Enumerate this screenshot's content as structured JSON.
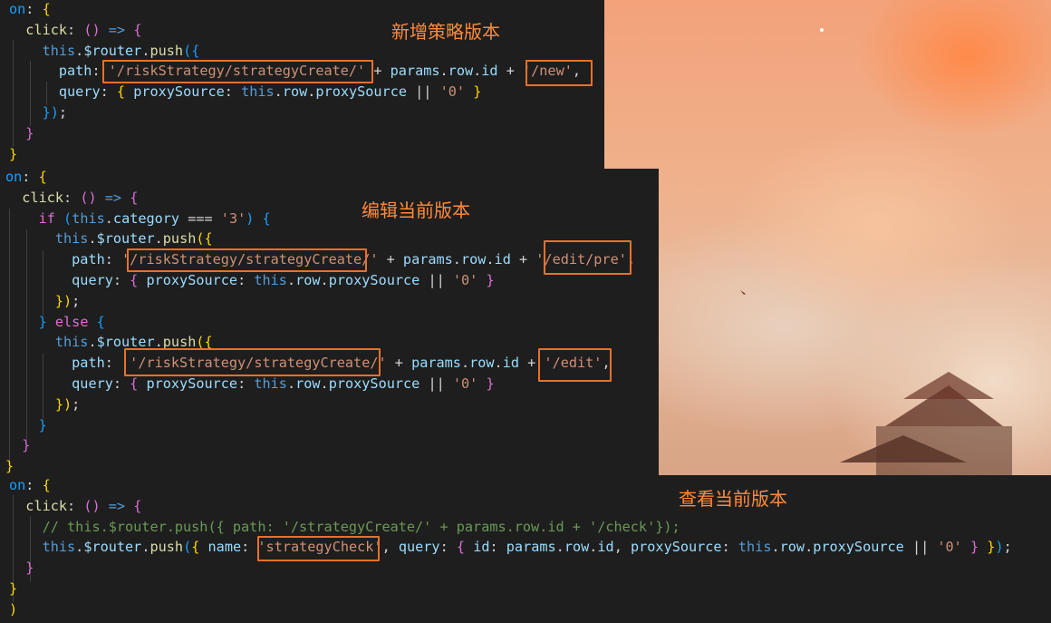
{
  "annotations": {
    "new_version": "新增策略版本",
    "edit_version": "编辑当前版本",
    "view_version": "查看当前版本"
  },
  "panel_1": {
    "lines": [
      [
        [
          "b",
          "on"
        ],
        [
          "w",
          ": "
        ],
        [
          "y",
          "{"
        ]
      ],
      [
        [
          "w",
          "  "
        ],
        [
          "f",
          "click"
        ],
        [
          "w",
          ": "
        ],
        [
          "pk",
          "()"
        ],
        [
          "w",
          " "
        ],
        [
          "k",
          "=>"
        ],
        [
          "w",
          " "
        ],
        [
          "pk",
          "{"
        ]
      ],
      [
        [
          "w",
          "    "
        ],
        [
          "k",
          "this"
        ],
        [
          "w",
          "."
        ],
        [
          "p",
          "$router"
        ],
        [
          "w",
          "."
        ],
        [
          "f",
          "push"
        ],
        [
          "b",
          "({"
        ]
      ],
      [
        [
          "w",
          "      "
        ],
        [
          "p",
          "path"
        ],
        [
          "w",
          ": "
        ],
        [
          "s",
          "'/riskStrategy/strategyCreate/'"
        ],
        [
          "w",
          " + "
        ],
        [
          "p",
          "params"
        ],
        [
          "w",
          "."
        ],
        [
          "p",
          "row"
        ],
        [
          "w",
          "."
        ],
        [
          "p",
          "id"
        ],
        [
          "w",
          " + "
        ],
        [
          "s",
          "'/new'"
        ],
        [
          "w",
          ","
        ]
      ],
      [
        [
          "w",
          "      "
        ],
        [
          "p",
          "query"
        ],
        [
          "w",
          ": "
        ],
        [
          "y",
          "{"
        ],
        [
          "w",
          " "
        ],
        [
          "p",
          "proxySource"
        ],
        [
          "w",
          ": "
        ],
        [
          "k",
          "this"
        ],
        [
          "w",
          "."
        ],
        [
          "p",
          "row"
        ],
        [
          "w",
          "."
        ],
        [
          "p",
          "proxySource"
        ],
        [
          "w",
          " || "
        ],
        [
          "s",
          "'0'"
        ],
        [
          "w",
          " "
        ],
        [
          "y",
          "}"
        ]
      ],
      [
        [
          "w",
          "    "
        ],
        [
          "b",
          "})"
        ],
        [
          "w",
          ";"
        ]
      ],
      [
        [
          "w",
          "  "
        ],
        [
          "pk",
          "}"
        ]
      ],
      [
        [
          "y",
          "}"
        ]
      ]
    ]
  },
  "panel_2": {
    "lines": [
      [
        [
          "b",
          "on"
        ],
        [
          "w",
          ": "
        ],
        [
          "y",
          "{"
        ]
      ],
      [
        [
          "w",
          "  "
        ],
        [
          "f",
          "click"
        ],
        [
          "w",
          ": "
        ],
        [
          "pk",
          "()"
        ],
        [
          "w",
          " "
        ],
        [
          "k",
          "=>"
        ],
        [
          "w",
          " "
        ],
        [
          "pk",
          "{"
        ]
      ],
      [
        [
          "w",
          "    "
        ],
        [
          "pk",
          "if"
        ],
        [
          "w",
          " "
        ],
        [
          "b",
          "("
        ],
        [
          "k",
          "this"
        ],
        [
          "w",
          "."
        ],
        [
          "p",
          "category"
        ],
        [
          "w",
          " === "
        ],
        [
          "s",
          "'3'"
        ],
        [
          "b",
          ")"
        ],
        [
          "w",
          " "
        ],
        [
          "b",
          "{"
        ]
      ],
      [
        [
          "w",
          "      "
        ],
        [
          "k",
          "this"
        ],
        [
          "w",
          "."
        ],
        [
          "p",
          "$router"
        ],
        [
          "w",
          "."
        ],
        [
          "f",
          "push"
        ],
        [
          "y",
          "({"
        ]
      ],
      [
        [
          "w",
          "        "
        ],
        [
          "p",
          "path"
        ],
        [
          "w",
          ": "
        ],
        [
          "s",
          "'/riskStrategy/strategyCreate/'"
        ],
        [
          "w",
          " + "
        ],
        [
          "p",
          "params"
        ],
        [
          "w",
          "."
        ],
        [
          "p",
          "row"
        ],
        [
          "w",
          "."
        ],
        [
          "p",
          "id"
        ],
        [
          "w",
          " + "
        ],
        [
          "s",
          "'/edit/pre'"
        ],
        [
          "w",
          ","
        ]
      ],
      [
        [
          "w",
          "        "
        ],
        [
          "p",
          "query"
        ],
        [
          "w",
          ": "
        ],
        [
          "pk",
          "{"
        ],
        [
          "w",
          " "
        ],
        [
          "p",
          "proxySource"
        ],
        [
          "w",
          ": "
        ],
        [
          "k",
          "this"
        ],
        [
          "w",
          "."
        ],
        [
          "p",
          "row"
        ],
        [
          "w",
          "."
        ],
        [
          "p",
          "proxySource"
        ],
        [
          "w",
          " || "
        ],
        [
          "s",
          "'0'"
        ],
        [
          "w",
          " "
        ],
        [
          "pk",
          "}"
        ]
      ],
      [
        [
          "w",
          "      "
        ],
        [
          "y",
          "})"
        ],
        [
          "w",
          ";"
        ]
      ],
      [
        [
          "w",
          "    "
        ],
        [
          "b",
          "}"
        ],
        [
          "w",
          " "
        ],
        [
          "pk",
          "else"
        ],
        [
          "w",
          " "
        ],
        [
          "b",
          "{"
        ]
      ],
      [
        [
          "w",
          "      "
        ],
        [
          "k",
          "this"
        ],
        [
          "w",
          "."
        ],
        [
          "p",
          "$router"
        ],
        [
          "w",
          "."
        ],
        [
          "f",
          "push"
        ],
        [
          "y",
          "({"
        ]
      ],
      [
        [
          "w",
          "        "
        ],
        [
          "p",
          "path"
        ],
        [
          "w",
          ":  "
        ],
        [
          "s",
          "'/riskStrategy/strategyCreate/'"
        ],
        [
          "w",
          " + "
        ],
        [
          "p",
          "params"
        ],
        [
          "w",
          "."
        ],
        [
          "p",
          "row"
        ],
        [
          "w",
          "."
        ],
        [
          "p",
          "id"
        ],
        [
          "w",
          " + "
        ],
        [
          "s",
          "'/edit'"
        ],
        [
          "w",
          ","
        ]
      ],
      [
        [
          "w",
          "        "
        ],
        [
          "p",
          "query"
        ],
        [
          "w",
          ": "
        ],
        [
          "pk",
          "{"
        ],
        [
          "w",
          " "
        ],
        [
          "p",
          "proxySource"
        ],
        [
          "w",
          ": "
        ],
        [
          "k",
          "this"
        ],
        [
          "w",
          "."
        ],
        [
          "p",
          "row"
        ],
        [
          "w",
          "."
        ],
        [
          "p",
          "proxySource"
        ],
        [
          "w",
          " || "
        ],
        [
          "s",
          "'0'"
        ],
        [
          "w",
          " "
        ],
        [
          "pk",
          "}"
        ]
      ],
      [
        [
          "w",
          "      "
        ],
        [
          "y",
          "})"
        ],
        [
          "w",
          ";"
        ]
      ],
      [
        [
          "w",
          "    "
        ],
        [
          "b",
          "}"
        ]
      ],
      [
        [
          "w",
          "  "
        ],
        [
          "pk",
          "}"
        ]
      ],
      [
        [
          "y",
          "}"
        ]
      ]
    ]
  },
  "panel_3": {
    "lines": [
      [
        [
          "b",
          "on"
        ],
        [
          "w",
          ": "
        ],
        [
          "y",
          "{"
        ]
      ],
      [
        [
          "w",
          "  "
        ],
        [
          "f",
          "click"
        ],
        [
          "w",
          ": "
        ],
        [
          "pk",
          "()"
        ],
        [
          "w",
          " "
        ],
        [
          "k",
          "=>"
        ],
        [
          "w",
          " "
        ],
        [
          "pk",
          "{"
        ]
      ],
      [
        [
          "w",
          "    "
        ],
        [
          "c",
          "// this.$router.push({ path: '/strategyCreate/' + params.row.id + '/check'});"
        ]
      ],
      [
        [
          "w",
          "    "
        ],
        [
          "k",
          "this"
        ],
        [
          "w",
          "."
        ],
        [
          "p",
          "$router"
        ],
        [
          "w",
          "."
        ],
        [
          "f",
          "push"
        ],
        [
          "b",
          "("
        ],
        [
          "y",
          "{"
        ],
        [
          "w",
          " "
        ],
        [
          "p",
          "name"
        ],
        [
          "w",
          ": "
        ],
        [
          "s",
          "'strategyCheck'"
        ],
        [
          "w",
          ", "
        ],
        [
          "p",
          "query"
        ],
        [
          "w",
          ": "
        ],
        [
          "pk",
          "{"
        ],
        [
          "w",
          " "
        ],
        [
          "p",
          "id"
        ],
        [
          "w",
          ": "
        ],
        [
          "p",
          "params"
        ],
        [
          "w",
          "."
        ],
        [
          "p",
          "row"
        ],
        [
          "w",
          "."
        ],
        [
          "p",
          "id"
        ],
        [
          "w",
          ", "
        ],
        [
          "p",
          "proxySource"
        ],
        [
          "w",
          ": "
        ],
        [
          "k",
          "this"
        ],
        [
          "w",
          "."
        ],
        [
          "p",
          "row"
        ],
        [
          "w",
          "."
        ],
        [
          "p",
          "proxySource"
        ],
        [
          "w",
          " || "
        ],
        [
          "s",
          "'0'"
        ],
        [
          "w",
          " "
        ],
        [
          "pk",
          "}"
        ],
        [
          "w",
          " "
        ],
        [
          "y",
          "}"
        ],
        [
          "b",
          ")"
        ],
        [
          "w",
          ";"
        ]
      ],
      [
        [
          "w",
          "  "
        ],
        [
          "pk",
          "}"
        ]
      ],
      [
        [
          "y",
          "}"
        ]
      ],
      [
        [
          "y",
          ")"
        ]
      ]
    ]
  },
  "colors": {
    "highlight_border": "#e8712a",
    "annotation_text": "#ff8a3d",
    "editor_bg": "#1e1e1e"
  }
}
